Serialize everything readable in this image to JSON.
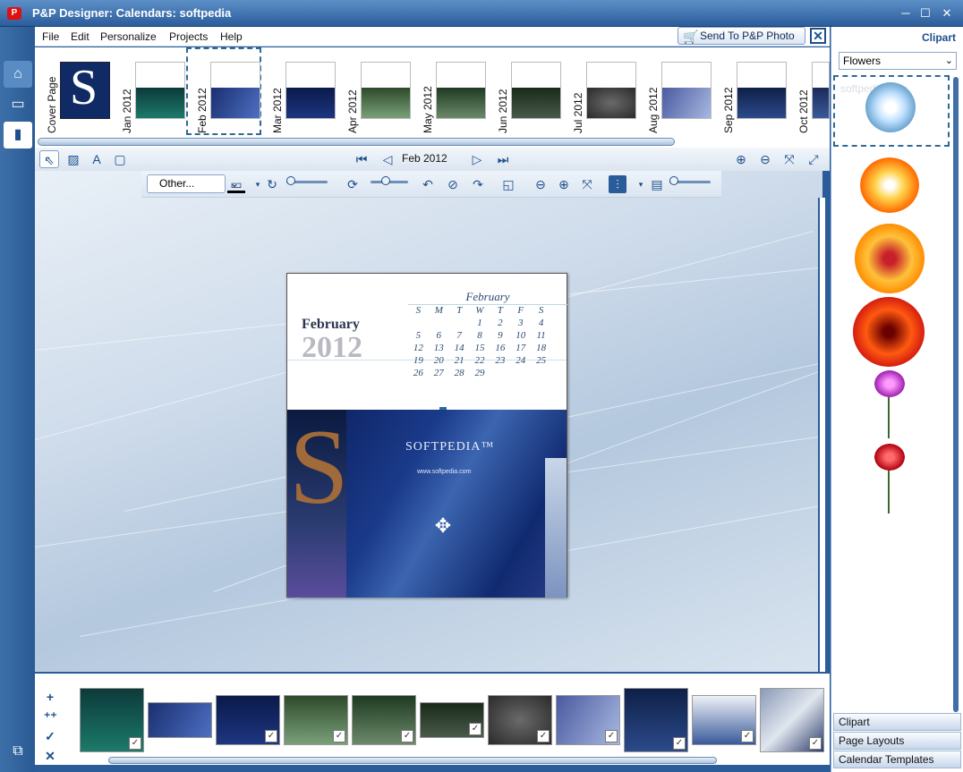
{
  "window": {
    "title": "P&P Designer: Calendars: softpedia",
    "minimize": "─",
    "maximize": "☐",
    "close": "✕"
  },
  "menu": {
    "items": [
      "File",
      "Edit",
      "Personalize",
      "Projects",
      "Help"
    ]
  },
  "send": {
    "label": "Send To  P&P Photo"
  },
  "pages": [
    {
      "label": "Cover Page"
    },
    {
      "label": "Jan  2012"
    },
    {
      "label": "Feb  2012"
    },
    {
      "label": "Mar  2012"
    },
    {
      "label": "Apr  2012"
    },
    {
      "label": "May  2012"
    },
    {
      "label": "Jun  2012"
    },
    {
      "label": "Jul  2012"
    },
    {
      "label": "Aug  2012"
    },
    {
      "label": "Sep  2012"
    },
    {
      "label": "Oct  2012"
    }
  ],
  "nav": {
    "current": "Feb  2012"
  },
  "toolbar": {
    "effect_select": "Other..."
  },
  "calendar_page": {
    "month": "February",
    "year": "2012",
    "grid_title": "February",
    "day_headers": [
      "S",
      "M",
      "T",
      "W",
      "T",
      "F",
      "S"
    ],
    "days": [
      "",
      "",
      "",
      "1",
      "2",
      "3",
      "4",
      "5",
      "6",
      "7",
      "8",
      "9",
      "10",
      "11",
      "12",
      "13",
      "14",
      "15",
      "16",
      "17",
      "18",
      "19",
      "20",
      "21",
      "22",
      "23",
      "24",
      "25",
      "26",
      "27",
      "28",
      "29",
      "",
      "",
      ""
    ],
    "photo_brand": "SOFTPEDIA™",
    "photo_url": "www.softpedia.com"
  },
  "right_panel": {
    "title": "Clipart",
    "category": "Flowers",
    "watermark": "softpedia.com",
    "tabs": [
      "Clipart",
      "Page Layouts",
      "Calendar Templates"
    ]
  },
  "colors": {
    "titlebar": "#2b5d9c",
    "accent": "#1d4f8c",
    "canvas": "#cfdceb"
  },
  "icons": [
    "home-icon",
    "book-icon",
    "calendar-icon",
    "pointer-icon",
    "add-image-icon",
    "add-text-icon",
    "add-frame-icon",
    "zoom-in-icon",
    "zoom-out-icon",
    "fit-icon",
    "fullscreen-icon",
    "cart-icon",
    "close-icon"
  ]
}
